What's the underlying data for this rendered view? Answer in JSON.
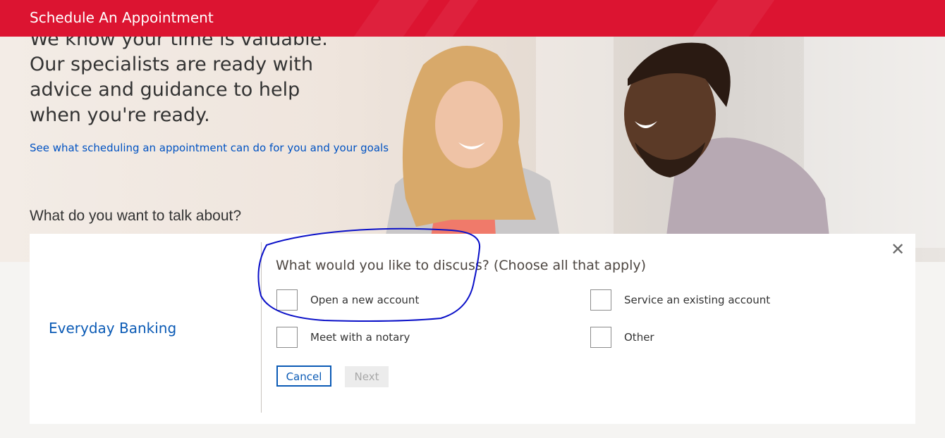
{
  "header": {
    "title": "Schedule An Appointment"
  },
  "hero": {
    "tagline": "We know your time is valuable. Our specialists are ready with advice and guidance to help when you're ready.",
    "link": "See what scheduling an appointment can do for you and your goals",
    "question": "What do you want to talk about?"
  },
  "panel": {
    "category": "Everyday Banking",
    "prompt": "What would you like to discuss? (Choose all that apply)",
    "close_glyph": "✕",
    "options": [
      {
        "label": "Open a new account",
        "checked": false
      },
      {
        "label": "Service an existing account",
        "checked": false
      },
      {
        "label": "Meet with a notary",
        "checked": false
      },
      {
        "label": "Other",
        "checked": false
      }
    ],
    "cancel_label": "Cancel",
    "next_label": "Next",
    "next_enabled": false
  },
  "colors": {
    "header_red": "#dc1431",
    "link_blue": "#0052c2",
    "annotation_blue": "#0a10c8"
  }
}
